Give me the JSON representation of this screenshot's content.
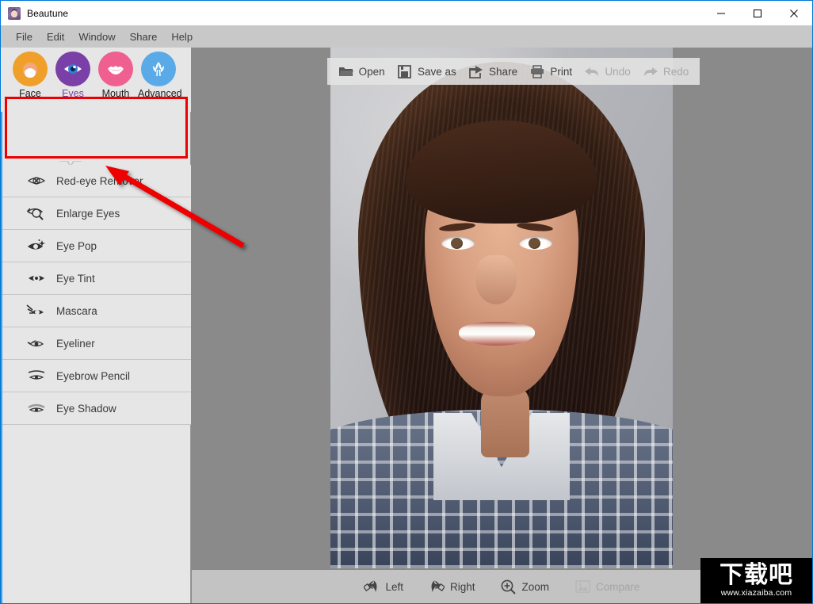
{
  "window": {
    "title": "Beautune",
    "icon": "app-avatar-icon",
    "controls": [
      {
        "name": "minimize",
        "glyph": "—"
      },
      {
        "name": "maximize",
        "glyph": "□"
      },
      {
        "name": "close",
        "glyph": "✕"
      }
    ]
  },
  "menubar": {
    "items": [
      "File",
      "Edit",
      "Window",
      "Share",
      "Help"
    ]
  },
  "categories": {
    "active": "Eyes",
    "items": [
      {
        "label": "Face",
        "icon": "face-icon",
        "color": "#f0a02a",
        "active": false
      },
      {
        "label": "Eyes",
        "icon": "eye-icon",
        "color": "#7b3fa8",
        "active": true
      },
      {
        "label": "Mouth",
        "icon": "lips-icon",
        "color": "#ef5f90",
        "active": false
      },
      {
        "label": "Advanced",
        "icon": "flower-icon",
        "color": "#5aaae8",
        "active": false
      }
    ],
    "highlight_color": "#ee0000"
  },
  "sidebar": {
    "items": [
      {
        "label": "Red-eye Remover",
        "icon": "red-eye-remover-icon"
      },
      {
        "label": "Enlarge Eyes",
        "icon": "enlarge-eyes-icon"
      },
      {
        "label": "Eye Pop",
        "icon": "eye-pop-icon"
      },
      {
        "label": "Eye Tint",
        "icon": "eye-tint-icon"
      },
      {
        "label": "Mascara",
        "icon": "mascara-icon"
      },
      {
        "label": "Eyeliner",
        "icon": "eyeliner-icon"
      },
      {
        "label": "Eyebrow Pencil",
        "icon": "eyebrow-pencil-icon"
      },
      {
        "label": "Eye Shadow",
        "icon": "eye-shadow-icon"
      }
    ]
  },
  "top_toolbar": {
    "items": [
      {
        "label": "Open",
        "icon": "folder-open-icon",
        "disabled": false
      },
      {
        "label": "Save as",
        "icon": "save-icon",
        "disabled": false
      },
      {
        "label": "Share",
        "icon": "share-icon",
        "disabled": false
      },
      {
        "label": "Print",
        "icon": "printer-icon",
        "disabled": false
      },
      {
        "label": "Undo",
        "icon": "undo-arrow-icon",
        "disabled": true
      },
      {
        "label": "Redo",
        "icon": "redo-arrow-icon",
        "disabled": true
      }
    ]
  },
  "bottom_toolbar": {
    "items": [
      {
        "label": "Left",
        "icon": "rotate-left-icon",
        "disabled": false
      },
      {
        "label": "Right",
        "icon": "rotate-right-icon",
        "disabled": false
      },
      {
        "label": "Zoom",
        "icon": "zoom-in-icon",
        "disabled": false
      },
      {
        "label": "Compare",
        "icon": "compare-image-icon",
        "disabled": true
      }
    ]
  },
  "canvas": {
    "photo_alt": "portrait-photo-of-woman",
    "background_color": "#8a8a8a"
  },
  "annotation": {
    "arrow_color": "#ee0000",
    "points_to": "Eyes category button"
  },
  "watermark": {
    "text_cn": "下载吧",
    "url": "www.xiazaiba.com"
  }
}
